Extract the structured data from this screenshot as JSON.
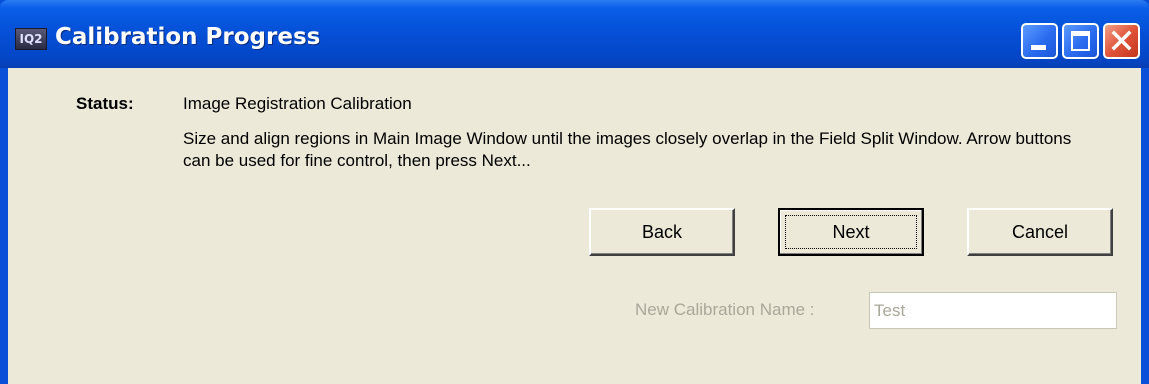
{
  "window": {
    "title": "Calibration Progress",
    "app_icon_text": "IQ2",
    "controls": {
      "minimize": "minimize-icon",
      "maximize": "maximize-icon",
      "close": "close-icon"
    }
  },
  "status": {
    "label": "Status:",
    "title": "Image Registration Calibration",
    "description": "Size and align regions in Main Image Window until the images closely overlap in the Field Split Window. Arrow buttons can be used for fine control, then press Next..."
  },
  "buttons": {
    "back": "Back",
    "next": "Next",
    "cancel": "Cancel"
  },
  "calibration_name": {
    "label": "New Calibration Name :",
    "value": "Test",
    "disabled": true
  },
  "colors": {
    "titlebar": "#0551d8",
    "client_background": "#ece9d8",
    "close_button": "#e0553a",
    "disabled_text": "#a8a799"
  }
}
